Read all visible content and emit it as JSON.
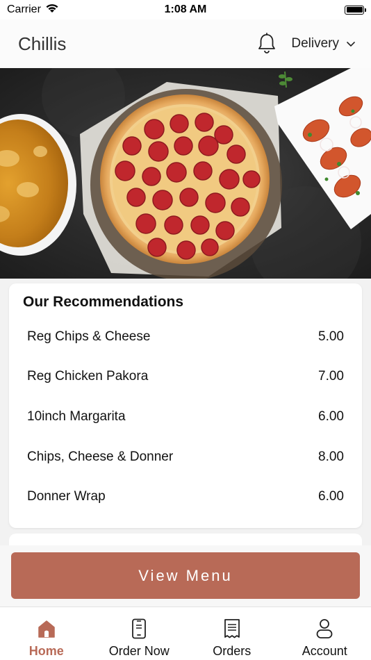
{
  "status_bar": {
    "carrier": "Carrier",
    "time": "1:08 AM"
  },
  "header": {
    "title": "Chillis",
    "delivery_mode": "Delivery"
  },
  "recommendations": {
    "title": "Our Recommendations",
    "items": [
      {
        "name": "Reg Chips & Cheese",
        "price": "5.00"
      },
      {
        "name": "Reg Chicken Pakora",
        "price": "7.00"
      },
      {
        "name": "10inch Margarita",
        "price": "6.00"
      },
      {
        "name": "Chips, Cheese & Donner",
        "price": "8.00"
      },
      {
        "name": "Donner Wrap",
        "price": "6.00"
      }
    ]
  },
  "view_menu_label": "View Menu",
  "nav": [
    {
      "label": "Home",
      "icon": "home-icon",
      "active": true
    },
    {
      "label": "Order Now",
      "icon": "phone-icon",
      "active": false
    },
    {
      "label": "Orders",
      "icon": "receipt-icon",
      "active": false
    },
    {
      "label": "Account",
      "icon": "person-icon",
      "active": false
    }
  ],
  "colors": {
    "accent": "#b86a57",
    "background": "#f2f2f2"
  }
}
